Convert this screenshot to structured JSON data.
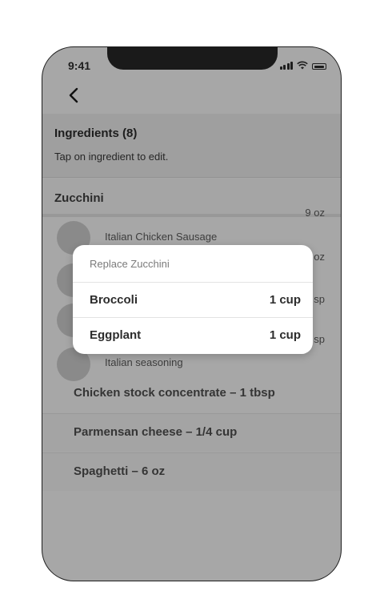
{
  "status_bar": {
    "time": "9:41",
    "icons": [
      "signal-icon",
      "wifi-icon",
      "battery-icon"
    ]
  },
  "nav": {
    "back_icon": "chevron-left-icon"
  },
  "header": {
    "title": "Ingredients (8)",
    "subtitle": "Tap on ingredient to edit."
  },
  "selected_ingredient": {
    "name": "Zucchini"
  },
  "substitutes": [
    {
      "name": "Italian Chicken Sausage",
      "qty": "9 oz"
    },
    {
      "name": "",
      "qty": "oz"
    },
    {
      "name": "",
      "qty": "sp"
    },
    {
      "name": "",
      "qty": "sp"
    },
    {
      "name": "Italian seasoning",
      "qty": ""
    }
  ],
  "ingredients": [
    {
      "label": "Chicken stock concentrate – 1 tbsp"
    },
    {
      "label": "Parmensan cheese – 1/4 cup"
    },
    {
      "label": "Spaghetti – 6 oz"
    }
  ],
  "popup": {
    "title": "Replace Zucchini",
    "options": [
      {
        "name": "Broccoli",
        "qty": "1 cup"
      },
      {
        "name": "Eggplant",
        "qty": "1 cup"
      }
    ]
  },
  "colors": {
    "overlay_gray": "#a7a7a7",
    "popup_bg": "#ffffff"
  }
}
